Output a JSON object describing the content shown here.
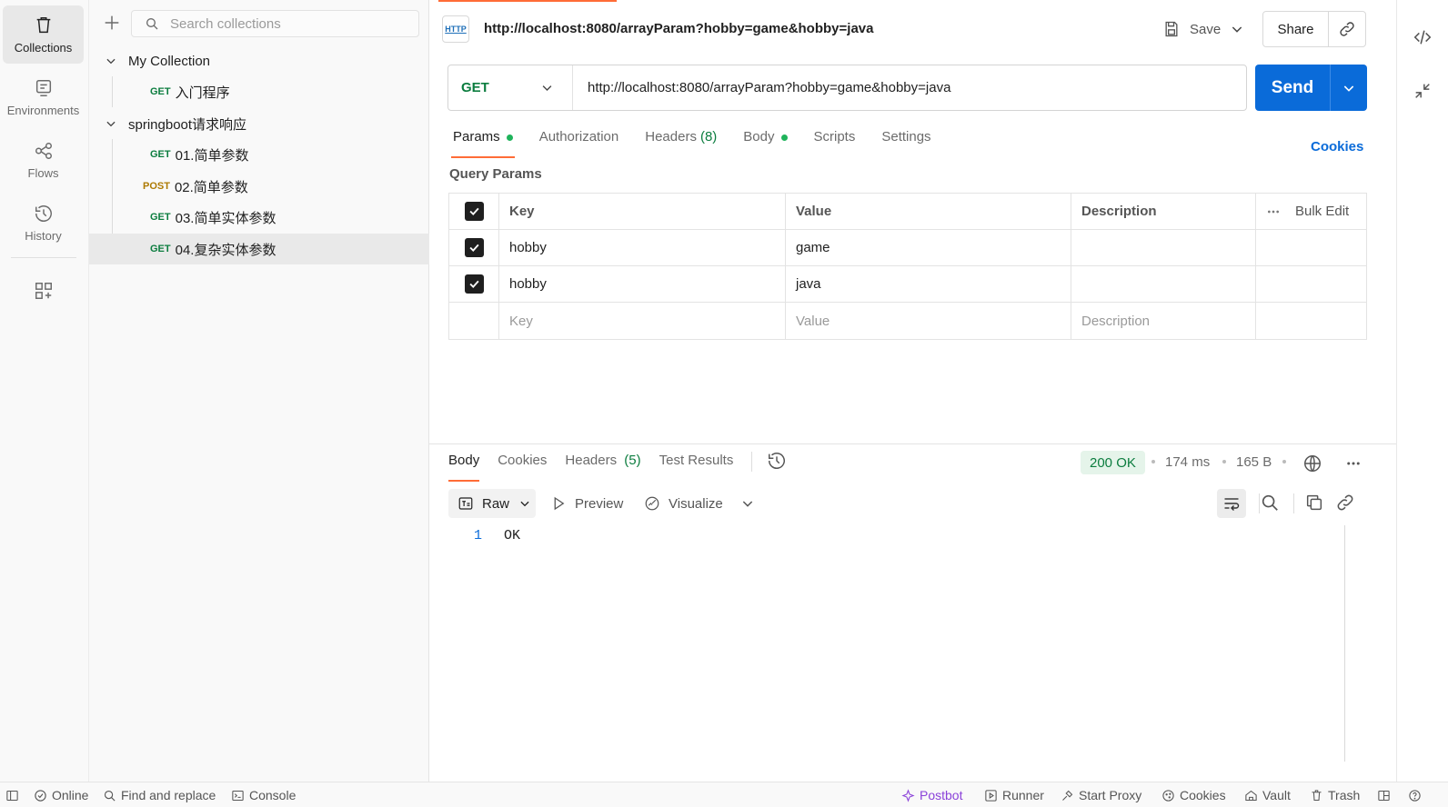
{
  "rail": {
    "items": [
      {
        "label": "Collections"
      },
      {
        "label": "Environments"
      },
      {
        "label": "Flows"
      },
      {
        "label": "History"
      }
    ]
  },
  "sidebar": {
    "search_placeholder": "Search collections",
    "tree": [
      {
        "label": "My Collection",
        "type": "collection"
      },
      {
        "method": "GET",
        "label": "入门程序",
        "type": "request"
      },
      {
        "label": "springboot请求响应",
        "type": "collection"
      },
      {
        "method": "GET",
        "label": "01.简单参数",
        "type": "request"
      },
      {
        "method": "POST",
        "label": "02.简单参数",
        "type": "request"
      },
      {
        "method": "GET",
        "label": "03.简单实体参数",
        "type": "request"
      },
      {
        "method": "GET",
        "label": "04.复杂实体参数",
        "type": "request",
        "selected": true
      }
    ]
  },
  "request": {
    "badge": "HTTP",
    "title": "http://localhost:8080/arrayParam?hobby=game&hobby=java",
    "save_label": "Save",
    "share_label": "Share",
    "method": "GET",
    "url": "http://localhost:8080/arrayParam?hobby=game&hobby=java",
    "send_label": "Send",
    "tabs": [
      {
        "label": "Params",
        "dot": true
      },
      {
        "label": "Authorization"
      },
      {
        "label": "Headers",
        "count": "(8)"
      },
      {
        "label": "Body",
        "dot": true
      },
      {
        "label": "Scripts"
      },
      {
        "label": "Settings"
      }
    ],
    "cookies_label": "Cookies",
    "query_params_label": "Query Params",
    "table": {
      "headers": {
        "key": "Key",
        "value": "Value",
        "description": "Description",
        "bulk_edit": "Bulk Edit"
      },
      "rows": [
        {
          "checked": true,
          "key": "hobby",
          "value": "game",
          "description": ""
        },
        {
          "checked": true,
          "key": "hobby",
          "value": "java",
          "description": ""
        }
      ],
      "placeholders": {
        "key": "Key",
        "value": "Value",
        "description": "Description"
      }
    }
  },
  "response": {
    "tabs": [
      {
        "label": "Body"
      },
      {
        "label": "Cookies"
      },
      {
        "label": "Headers",
        "count": "(5)"
      },
      {
        "label": "Test Results"
      }
    ],
    "status": "200 OK",
    "time": "174 ms",
    "size": "165 B",
    "format": "Raw",
    "preview_label": "Preview",
    "visualize_label": "Visualize",
    "line_number": "1",
    "body": "OK"
  },
  "statusbar": {
    "online": "Online",
    "find_replace": "Find and replace",
    "console": "Console",
    "postbot": "Postbot",
    "runner": "Runner",
    "start_proxy": "Start Proxy",
    "cookies": "Cookies",
    "vault": "Vault",
    "trash": "Trash"
  },
  "colors": {
    "accent": "#ff6c37",
    "send": "#0a6bd9",
    "get": "#0c7d3f",
    "post": "#ad7a03",
    "ok": "#0c7d3f"
  }
}
